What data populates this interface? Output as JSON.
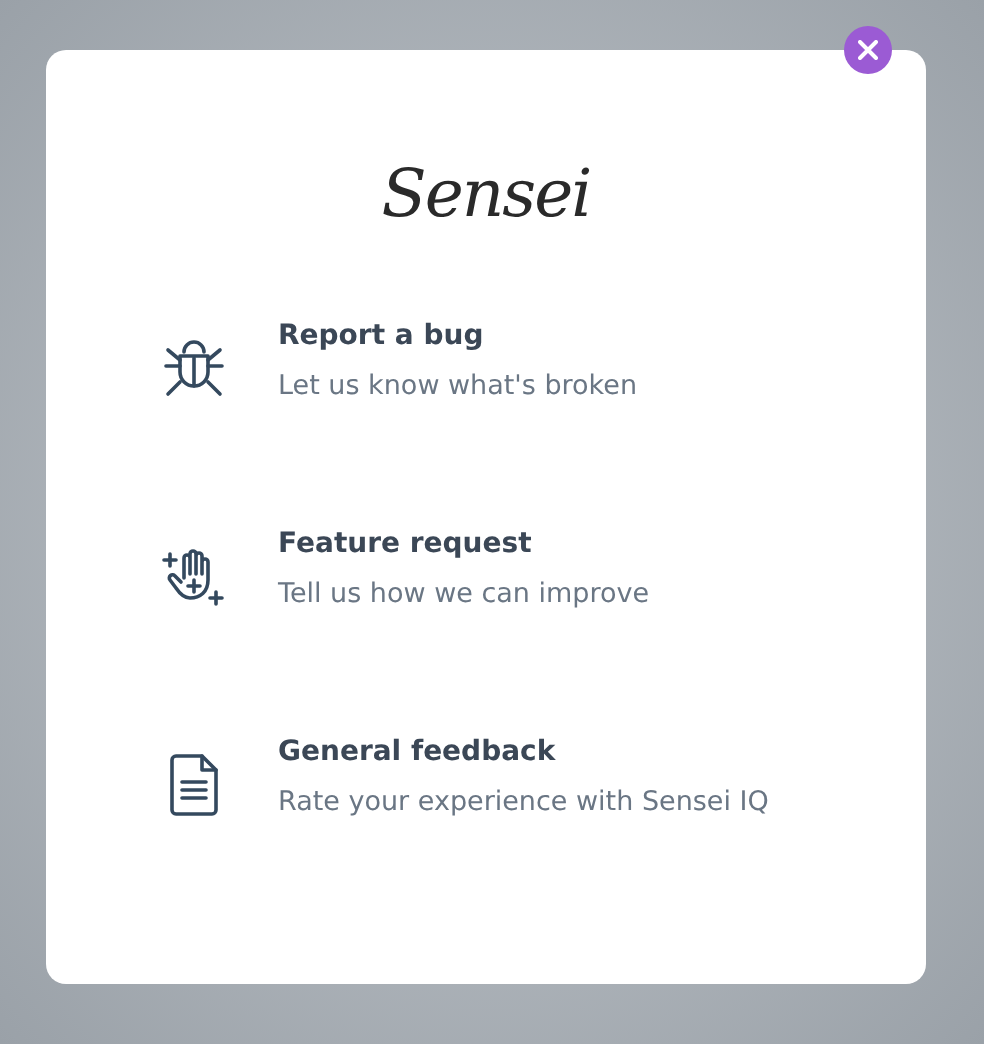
{
  "logo": "Sensei",
  "options": [
    {
      "kind": "bug",
      "title": "Report a bug",
      "subtitle": "Let us know what's broken"
    },
    {
      "kind": "hand",
      "title": "Feature request",
      "subtitle": "Tell us how we can improve"
    },
    {
      "kind": "document",
      "title": "General feedback",
      "subtitle": "Rate your experience with Sensei IQ"
    }
  ]
}
